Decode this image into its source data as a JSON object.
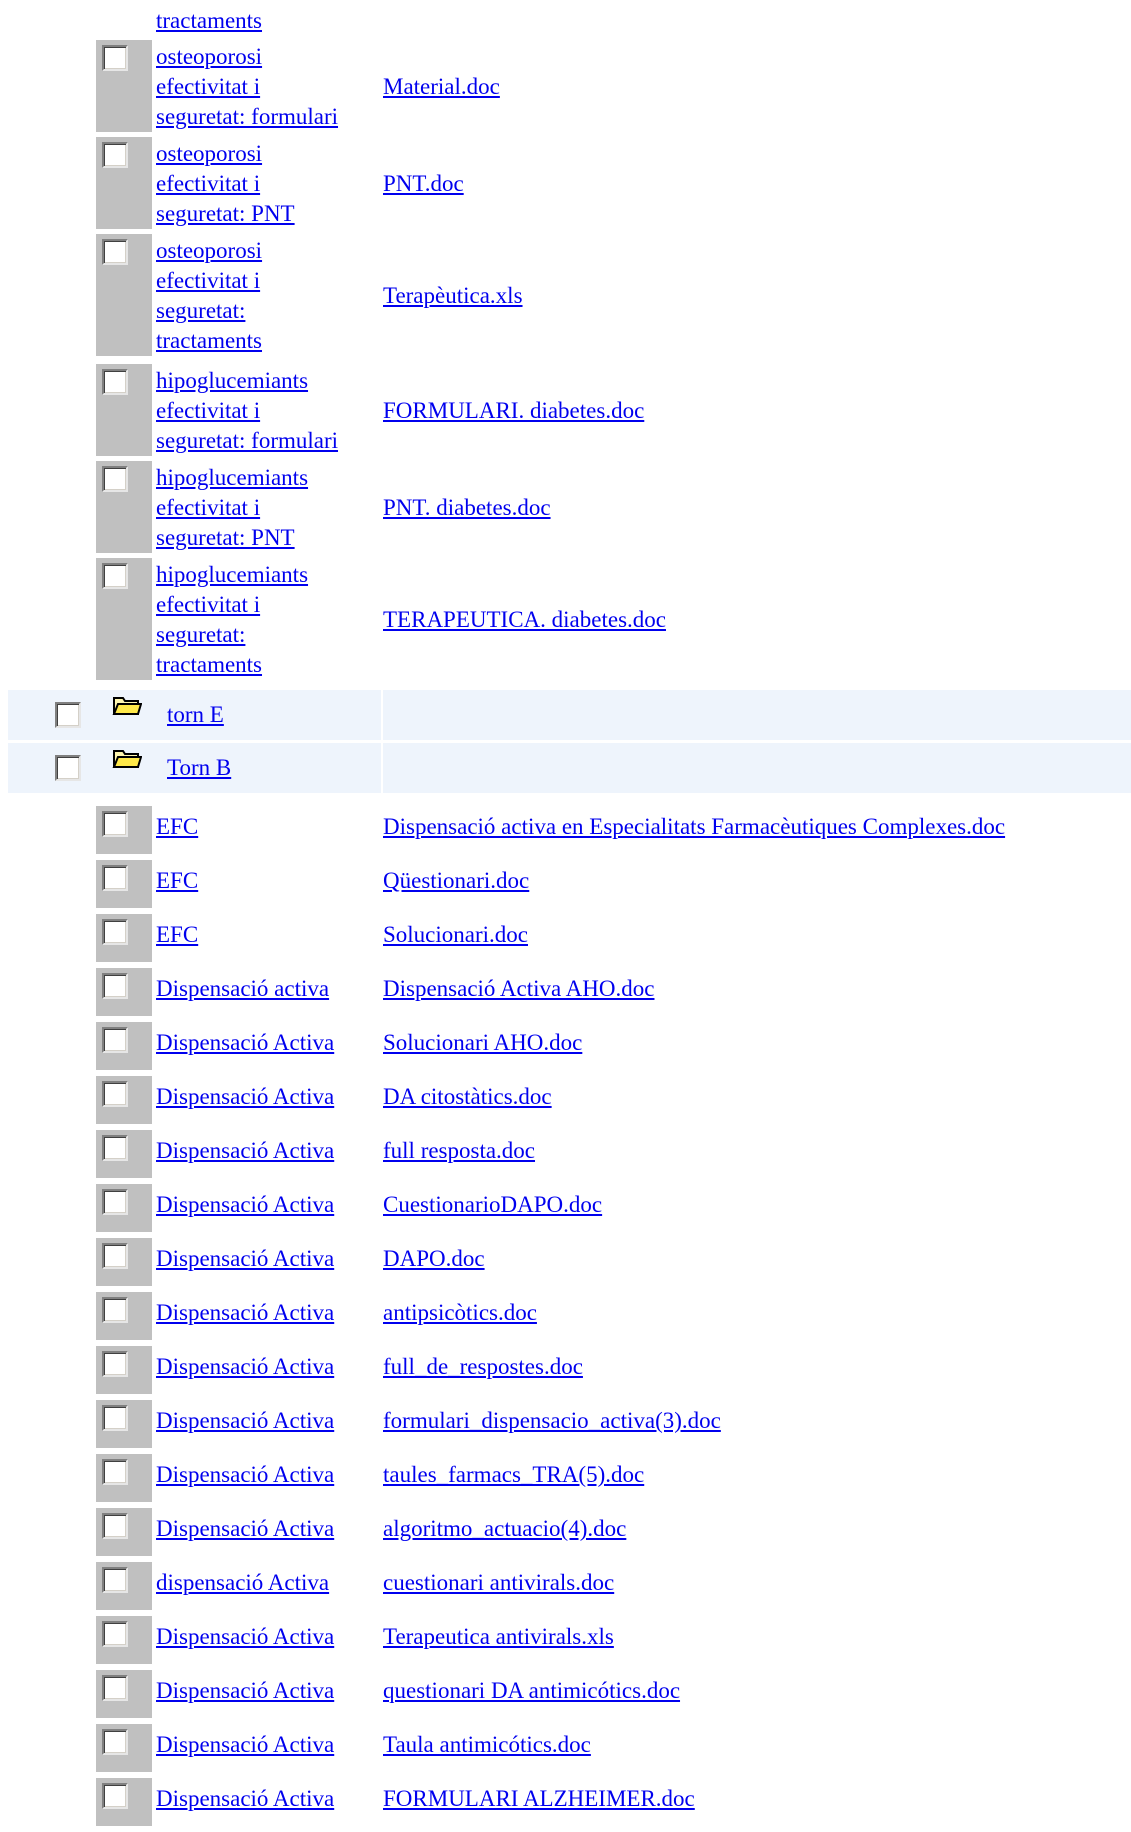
{
  "top_fragment": "tractaments",
  "multi_rows": [
    {
      "name_lines": [
        "osteoporosi",
        "efectivitat i",
        "seguretat: formulari"
      ],
      "file": "Material.doc"
    },
    {
      "name_lines": [
        "osteoporosi",
        "efectivitat i",
        "seguretat: PNT"
      ],
      "file": "PNT.doc"
    },
    {
      "name_lines": [
        "osteoporosi",
        "efectivitat i",
        "seguretat:",
        "tractaments"
      ],
      "file": "Terapèutica.xls"
    },
    {
      "name_lines": [
        "hipoglucemiants",
        "efectivitat i",
        "seguretat: formulari"
      ],
      "file": "FORMULARI. diabetes.doc"
    },
    {
      "name_lines": [
        "hipoglucemiants",
        "efectivitat i",
        "seguretat: PNT"
      ],
      "file": "PNT. diabetes.doc"
    },
    {
      "name_lines": [
        "hipoglucemiants",
        "efectivitat i",
        "seguretat:",
        "tractaments"
      ],
      "file": "TERAPEUTICA. diabetes.doc"
    }
  ],
  "folders": [
    {
      "label": "torn E",
      "icon": "folder-icon"
    },
    {
      "label": "Torn B",
      "icon": "folder-icon"
    }
  ],
  "single_rows": [
    {
      "name": "EFC",
      "file": "Dispensació activa en Especialitats Farmacèutiques Complexes.doc"
    },
    {
      "name": "EFC",
      "file": "Qüestionari.doc"
    },
    {
      "name": "EFC",
      "file": "Solucionari.doc"
    },
    {
      "name": "Dispensació activa",
      "file": "Dispensació Activa AHO.doc"
    },
    {
      "name": "Dispensació Activa",
      "file": "Solucionari AHO.doc"
    },
    {
      "name": "Dispensació Activa",
      "file": "DA citostàtics.doc"
    },
    {
      "name": "Dispensació Activa",
      "file": "full resposta.doc"
    },
    {
      "name": "Dispensació Activa",
      "file": "CuestionarioDAPO.doc"
    },
    {
      "name": "Dispensació Activa",
      "file": "DAPO.doc"
    },
    {
      "name": "Dispensació Activa",
      "file": "antipsicòtics.doc"
    },
    {
      "name": "Dispensació Activa",
      "file": "full_de_respostes.doc"
    },
    {
      "name": "Dispensació Activa",
      "file": "formulari_dispensacio_activa(3).doc"
    },
    {
      "name": "Dispensació Activa",
      "file": "taules_farmacs_TRA(5).doc"
    },
    {
      "name": "Dispensació Activa",
      "file": "algoritmo_actuacio(4).doc"
    },
    {
      "name": "dispensació Activa",
      "file": "cuestionari antivirals.doc"
    },
    {
      "name": "Dispensació Activa",
      "file": "Terapeutica antivirals.xls"
    },
    {
      "name": "Dispensació Activa",
      "file": "questionari DA antimicótics.doc"
    },
    {
      "name": "Dispensació Activa",
      "file": "Taula antimicótics.doc"
    },
    {
      "name": "Dispensació Activa",
      "file": "FORMULARI ALZHEIMER.doc"
    }
  ],
  "colors": {
    "link": "#0000ee",
    "folder_row_bg": "#eef4fc",
    "checkbox_cell_bg": "#c0c0c0"
  }
}
